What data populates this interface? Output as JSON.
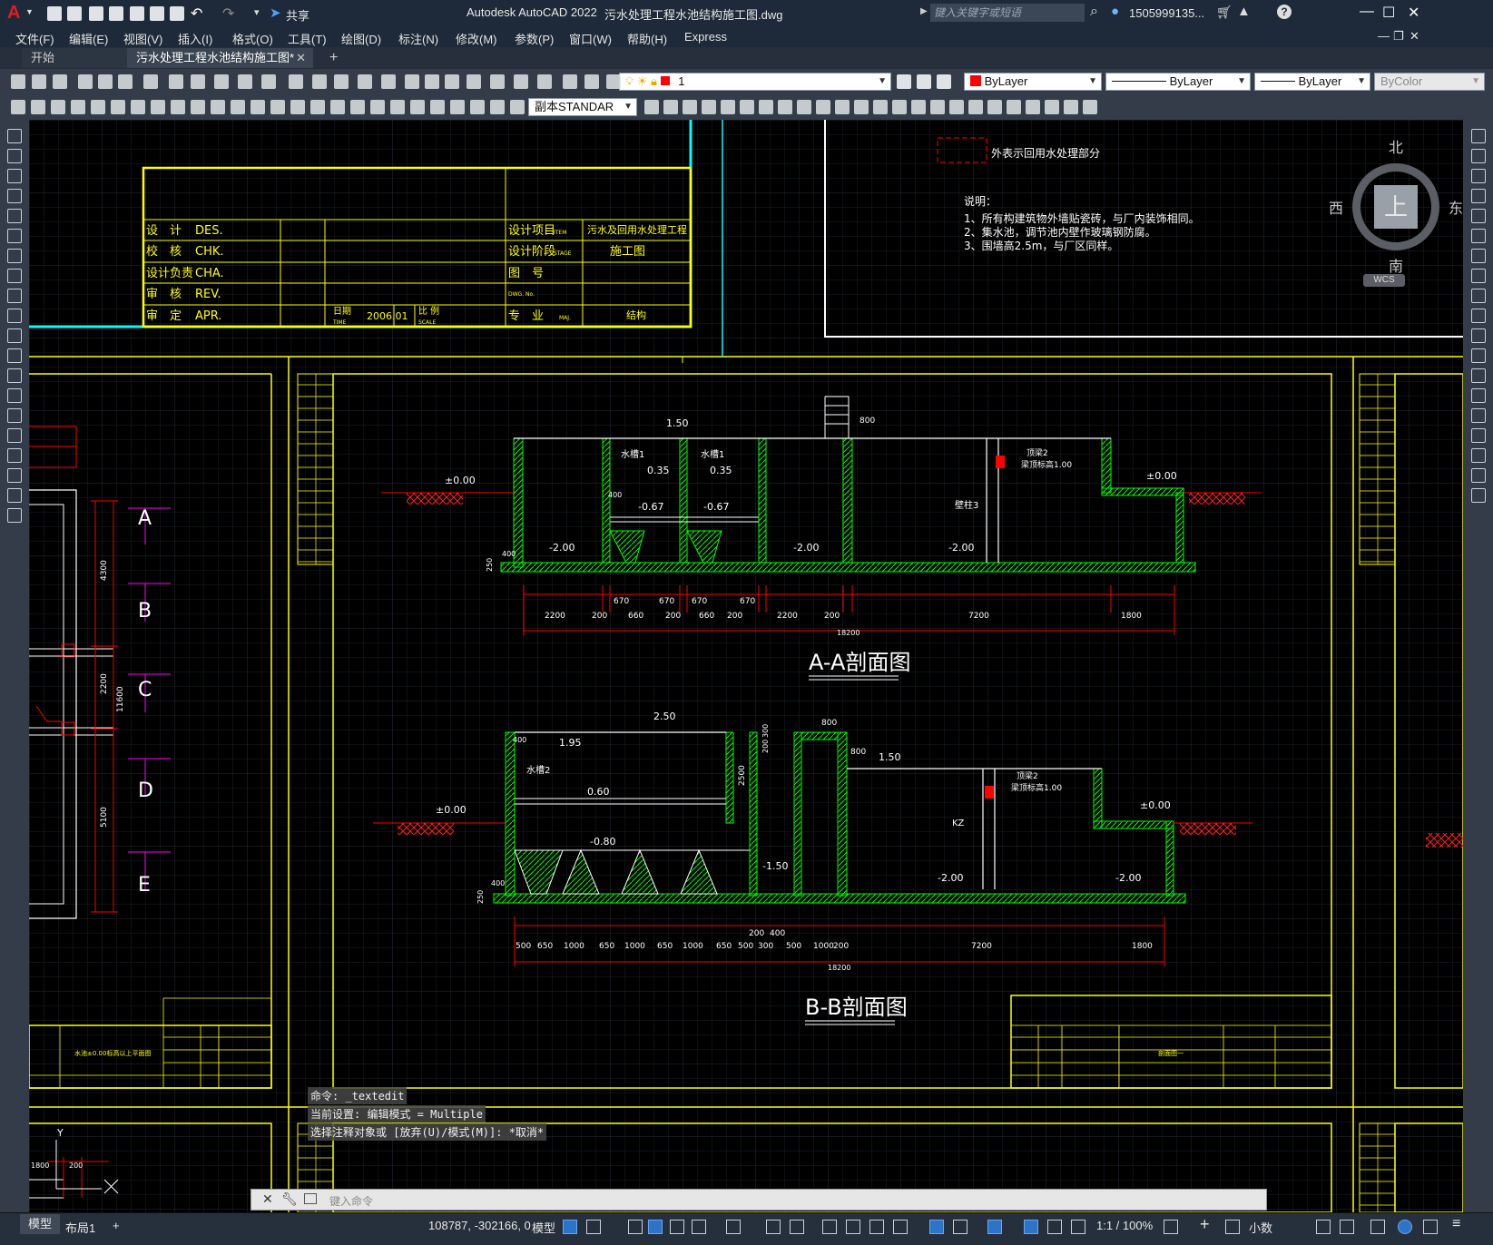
{
  "app": {
    "title": "Autodesk AutoCAD 2022",
    "document": "污水处理工程水池结构施工图.dwg",
    "share": "共享",
    "search_placeholder": "键入关键字或短语",
    "user": "1505999135...",
    "logo": "A"
  },
  "menu": [
    "文件(F)",
    "编辑(E)",
    "视图(V)",
    "插入(I)",
    "格式(O)",
    "工具(T)",
    "绘图(D)",
    "标注(N)",
    "修改(M)",
    "参数(P)",
    "窗口(W)",
    "帮助(H)",
    "Express"
  ],
  "tabs": {
    "start": "开始",
    "active": "污水处理工程水池结构施工图*",
    "add": "+"
  },
  "toolbar": {
    "layer_value": "1",
    "color_value": "ByLayer",
    "linetype_value": "ByLayer",
    "lineweight_value": "ByLayer",
    "plotstyle_value": "ByColor",
    "textstyle_value": "副本STANDAR"
  },
  "viewcube": {
    "north": "北",
    "south": "南",
    "east": "东",
    "west": "西",
    "top": "上",
    "wcs": "WCS"
  },
  "drawing": {
    "legend_text": "外表示回用水处理部分",
    "notes_title": "说明：",
    "notes": [
      "1、所有构建筑物外墙贴瓷砖，与厂内装饰相同。",
      "2、集水池，调节池内壁作玻璃钢防腐。",
      "3、围墙高2.5m，与厂区同样。"
    ],
    "title_block": {
      "design": "设　计",
      "design_en": "DES.",
      "check": "校　核",
      "check_en": "CHK.",
      "charge": "设计负责",
      "charge_en": "CHA.",
      "review": "审　核",
      "review_en": "REV.",
      "approve": "审　定",
      "approve_en": "APR.",
      "date_label": "日期",
      "date_en": "TIME",
      "date": "2006.01",
      "scale_label": "比 例",
      "scale_en": "SCALE",
      "item_label": "设计项目",
      "item_en": "ITEM",
      "item_value": "污水及回用水处理工程",
      "stage_label": "设计阶段",
      "stage_en": "STAGE",
      "stage_value": "施工图",
      "drawing_no": "图　号",
      "drawing_no_en": "DWG. No.",
      "major": "专　业",
      "major_en": "MAJ.",
      "major_value": "结构"
    },
    "section_aa_title": "A-A剖面图",
    "section_bb_title": "B-B剖面图",
    "grid_labels": [
      "A",
      "B",
      "C",
      "D",
      "E"
    ],
    "aa_dims": [
      "2200",
      "200",
      "670",
      "660",
      "200",
      "670",
      "660",
      "200",
      "2200",
      "200",
      "7200",
      "1800"
    ],
    "aa_small_dims": [
      "670",
      "670",
      "670",
      "670"
    ],
    "aa_total": "18200",
    "bb_dims": [
      "500",
      "650",
      "1000",
      "650",
      "1000",
      "650",
      "1000",
      "650",
      "500",
      "300",
      "500",
      "1000",
      "200",
      "7200",
      "1800"
    ],
    "bb_small_dims": [
      "200",
      "400"
    ],
    "bb_total": "18200",
    "aa_labels": {
      "lvl1": "1.50",
      "lvl2": "0.35",
      "lvl3": "0.35",
      "lvl4": "-0.67",
      "lvl5": "-0.67",
      "lvl6": "-2.00",
      "lvl7": "-2.00",
      "lvl8": "-2.00",
      "lvl9": "±0.00",
      "lvl10": "±0.00",
      "tank1": "水槽1",
      "tank2": "水槽1",
      "beam": "顶梁2",
      "beam2": "梁顶标高1.00",
      "col": "壁柱3",
      "d800": "800",
      "d400": "400",
      "d250": "250"
    },
    "bb_labels": {
      "lvl1": "2.50",
      "lvl2": "1.95",
      "lvl3": "0.60",
      "lvl4": "-0.80",
      "lvl5": "-1.50",
      "lvl6": "-2.00",
      "lvl7": "-2.00",
      "lvl8": "1.50",
      "lvl9": "±0.00",
      "lvl10": "±0.00",
      "tank": "水槽2",
      "beam": "顶梁2",
      "beam2": "梁顶标高1.00",
      "kz": "KZ",
      "d800": "800",
      "d800b": "800",
      "d2500": "2500",
      "d200": "200",
      "d300": "300",
      "d400": "400",
      "d250": "250"
    },
    "left_dims": {
      "d4300": "4300",
      "d2200": "2200",
      "d11600": "11600",
      "d5100": "5100"
    },
    "left_tb_text": "水池±0.00标高以上平面图",
    "right_tb_text": "剖面图一",
    "bottom_dims": {
      "d1800": "1800",
      "d200": "200"
    }
  },
  "command": {
    "line1": "命令: _textedit",
    "line2": "当前设置: 编辑模式 = Multiple",
    "line3": "选择注释对象或 [放弃(U)/模式(M)]: *取消*",
    "input_placeholder": "键入命令"
  },
  "status": {
    "model_tab": "模型",
    "layout_tab": "布局1",
    "add": "+",
    "coords": "108787, -302166, 0",
    "space": "模型",
    "scale": "1:1 / 100%",
    "units": "小数"
  },
  "colors": {
    "yellow": "#ffff00",
    "cyan": "#00ffff",
    "green": "#00ff00",
    "red": "#ff0000",
    "magenta": "#ff00ff",
    "white": "#ffffff",
    "canvas": "#000000",
    "accent": "#2d74c9"
  }
}
